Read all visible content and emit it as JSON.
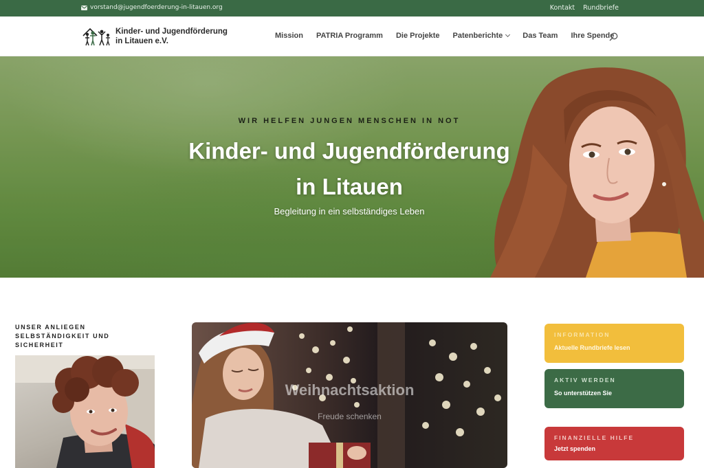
{
  "topbar": {
    "email": "vorstand@jugendfoerderung-in-litauen.org",
    "links": [
      "Kontakt",
      "Rundbriefe"
    ]
  },
  "logo": {
    "line1": "Kinder- und Jugendförderung",
    "line2": "in Litauen e.V."
  },
  "nav": {
    "items": [
      "Mission",
      "PATRIA Programm",
      "Die Projekte",
      "Patenberichte",
      "Das Team",
      "Ihre Spende"
    ]
  },
  "hero": {
    "kicker": "WIR HELFEN JUNGEN MENSCHEN IN NOT",
    "title_line1": "Kinder- und Jugendförderung",
    "title_line2": "in Litauen",
    "subtitle": "Begleitung in ein selbständiges Leben"
  },
  "anliegen": {
    "line1": "UNSER ANLIEGEN",
    "line2": "SELBSTÄNDIGKEIT UND",
    "line3": "SICHERHEIT"
  },
  "promo": {
    "title": "Weihnachtsaktion",
    "subtitle": "Freude schenken"
  },
  "cta": {
    "info": {
      "kicker": "INFORMATION",
      "text": "Aktuelle Rundbriefe lesen",
      "color": "#f2be3c"
    },
    "aktiv": {
      "kicker": "AKTIV WERDEN",
      "text": "So unterstützen Sie",
      "color": "#3c6b46"
    },
    "hilfe": {
      "kicker": "FINANZIELLE HILFE",
      "text": "Jetzt spenden",
      "color": "#c8393a"
    }
  },
  "colors": {
    "brand_green": "#3a6a45",
    "accent_yellow": "#f2be3c",
    "accent_red": "#c8393a"
  },
  "icons": {
    "mail": "mail-icon",
    "search": "search-icon",
    "chevron": "chevron-down-icon"
  }
}
